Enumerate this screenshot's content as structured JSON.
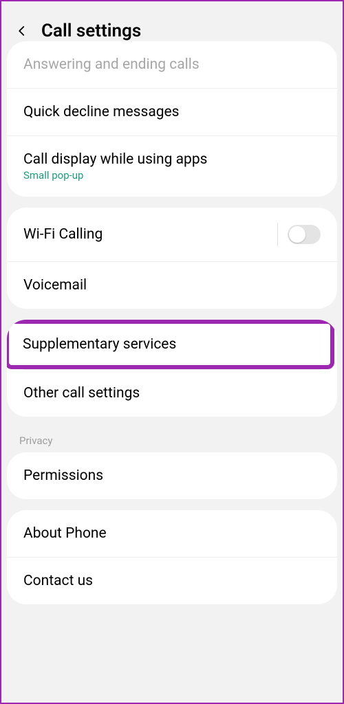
{
  "header": {
    "title": "Call settings"
  },
  "group1": {
    "answering_label": "Answering and ending calls",
    "quick_decline_label": "Quick decline messages",
    "call_display_label": "Call display while using apps",
    "call_display_subtitle": "Small pop-up"
  },
  "group2": {
    "wifi_calling_label": "Wi-Fi Calling",
    "wifi_calling_on": false,
    "voicemail_label": "Voicemail"
  },
  "group3": {
    "supplementary_label": "Supplementary services",
    "other_settings_label": "Other call settings"
  },
  "privacy_section_label": "Privacy",
  "group4": {
    "permissions_label": "Permissions"
  },
  "group5": {
    "about_label": "About Phone",
    "contact_label": "Contact us"
  },
  "highlight_color": "#9c27b0"
}
